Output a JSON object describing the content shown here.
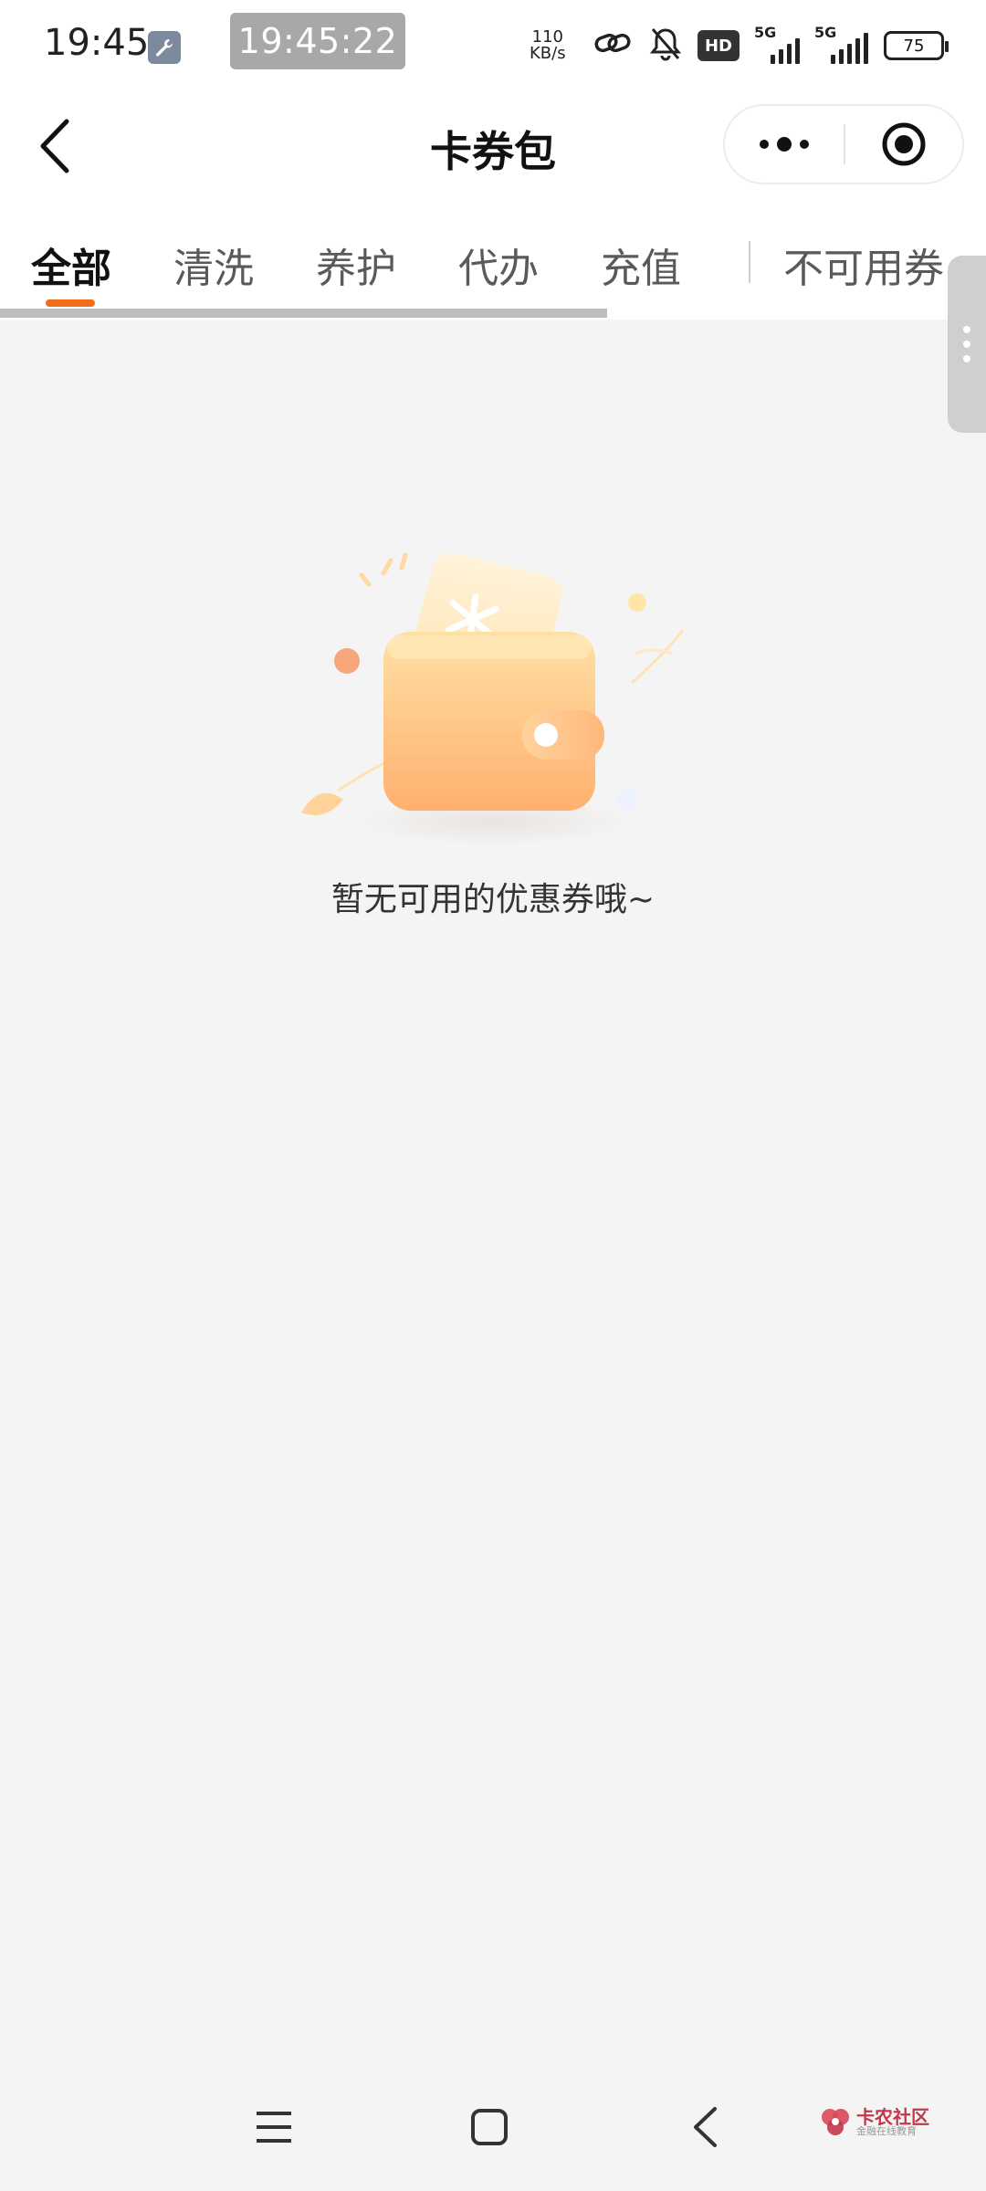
{
  "status_bar": {
    "time": "19:45",
    "clock_pill": "19:45:22",
    "net_speed_value": "110",
    "net_speed_unit": "KB/s",
    "hd_label": "HD",
    "signal1_label": "5G",
    "signal2_label": "5G",
    "battery": "75",
    "icons": [
      "wrench-icon",
      "link-icon",
      "bell-muted-icon",
      "hd-icon",
      "signal-icon",
      "battery-icon"
    ]
  },
  "header": {
    "title": "卡券包",
    "back_icon": "chevron-left-icon",
    "more_icon": "more-dots-icon",
    "target_icon": "target-icon"
  },
  "tabs": {
    "items": [
      {
        "label": "全部",
        "active": true
      },
      {
        "label": "清洗",
        "active": false
      },
      {
        "label": "养护",
        "active": false
      },
      {
        "label": "代办",
        "active": false
      },
      {
        "label": "充值",
        "active": false
      },
      {
        "label": "不可用券",
        "active": false
      }
    ]
  },
  "empty_state": {
    "message": "暂无可用的优惠券哦~",
    "illustration": "wallet-coupon-illustration"
  },
  "nav_bar": {
    "icons": [
      "menu-icon",
      "home-square-icon",
      "back-icon"
    ]
  },
  "watermark": {
    "title": "卡农社区",
    "subtitle": "金融在线教育"
  },
  "colors": {
    "accent": "#f06d1c",
    "background": "#f4f4f4",
    "header_bg": "#ffffff",
    "wallet": "#ffc27e"
  }
}
